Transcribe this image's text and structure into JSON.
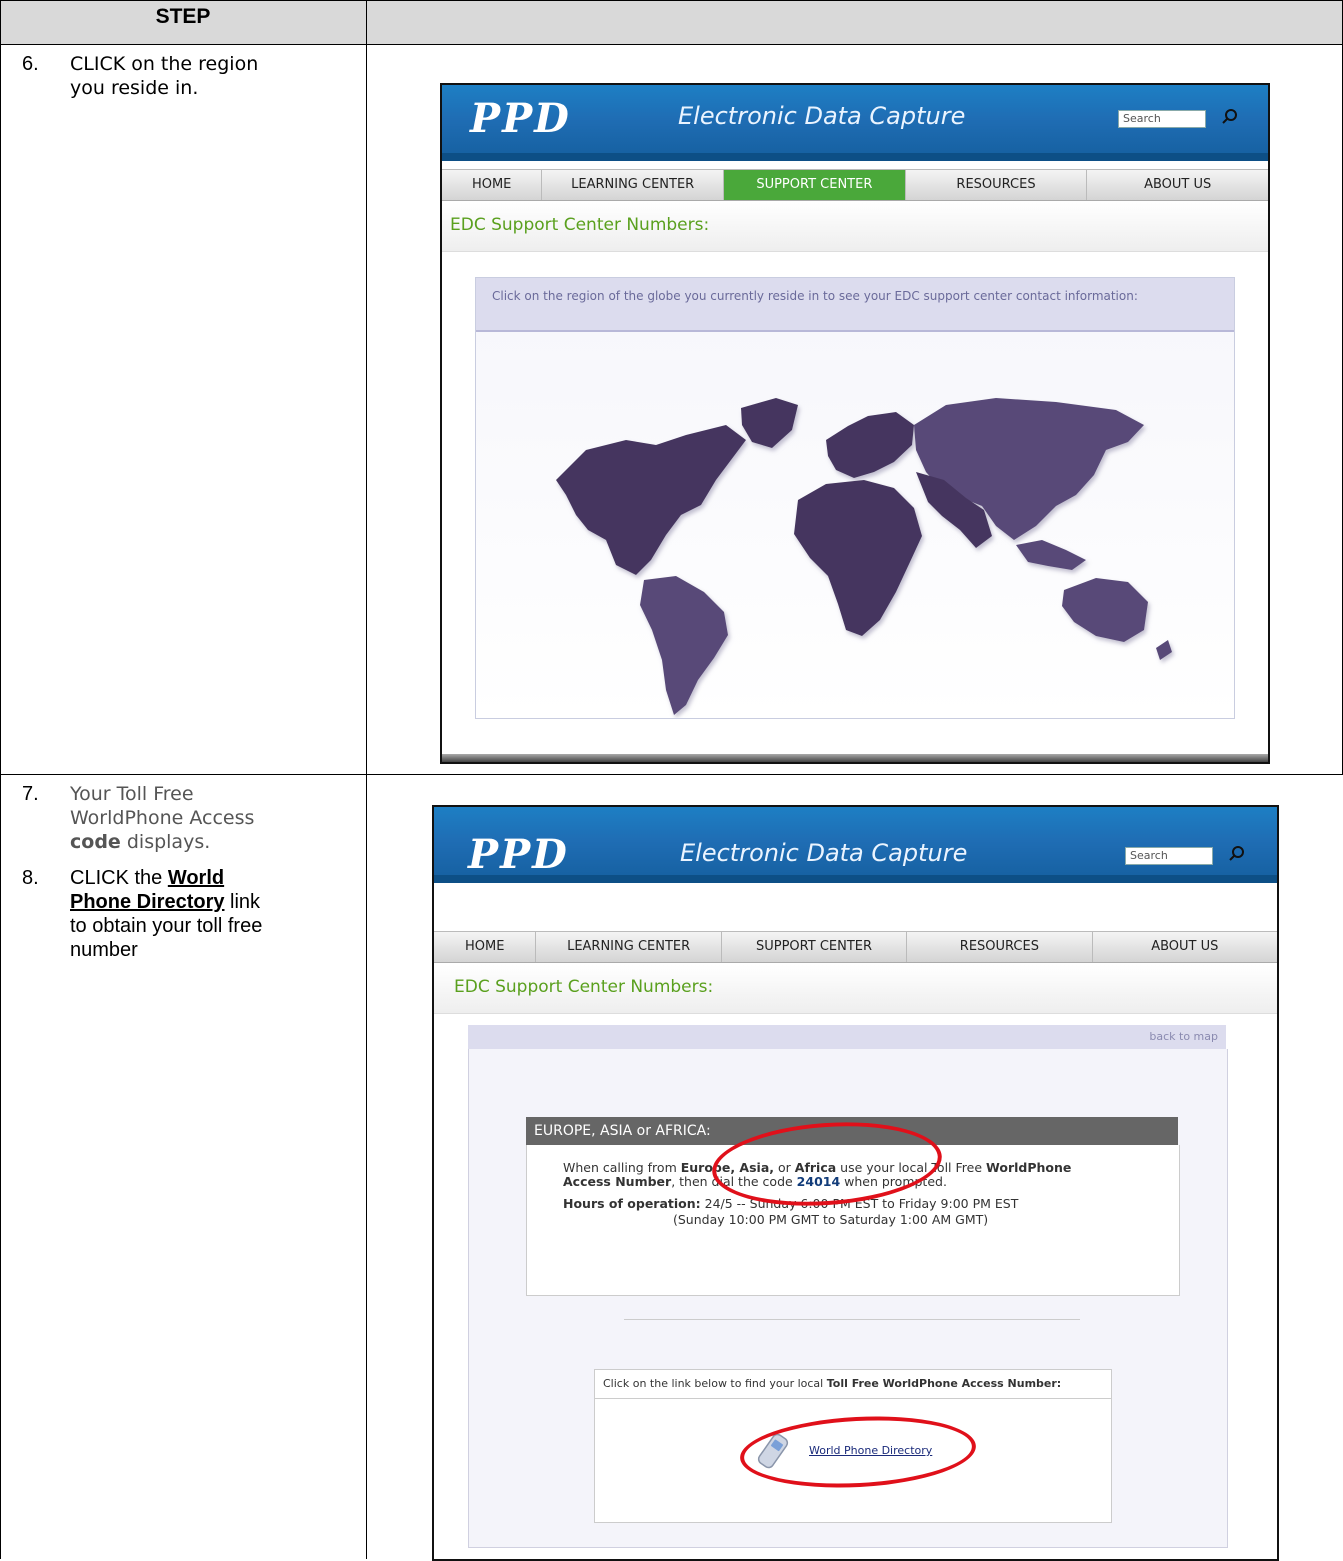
{
  "table": {
    "header_step": "STEP",
    "header_right": ""
  },
  "step6": {
    "number": "6.",
    "text_line1": "CLICK on the region",
    "text_line2": "you reside in."
  },
  "step7": {
    "number": "7.",
    "line1": "Your Toll Free",
    "line2": "WorldPhone Access",
    "line3_bold": "code",
    "line3_rest": " displays."
  },
  "step8": {
    "number": "8.",
    "pre": "CLICK the ",
    "link_line1": "World",
    "link_line2": "Phone Directory",
    "post1": " link",
    "line3": "to obtain your toll free",
    "line4": "number"
  },
  "app": {
    "logo": "PPD",
    "title": "Electronic Data Capture",
    "search_placeholder": "Search",
    "nav": [
      "HOME",
      "LEARNING CENTER",
      "SUPPORT CENTER",
      "RESOURCES",
      "ABOUT US"
    ],
    "active_nav": "SUPPORT CENTER",
    "page_title": "EDC Support Center Numbers:"
  },
  "shot1": {
    "instruction": "Click on the region of the globe you currently reside in to see your EDC support center contact information:"
  },
  "shot2": {
    "back_link": "back to map",
    "region_title": "EUROPE, ASIA or AFRICA:",
    "call_pre": "When calling from ",
    "call_regions_1": "Europe, Asia,",
    "call_or": " or ",
    "call_regions_2": "Africa",
    "call_mid": " use your local Toll Free ",
    "call_bold1": "WorldPhone",
    "call_bold2": "Access Number",
    "call_then": ", then dial the code ",
    "code": "24014",
    "call_end": " when prompted.",
    "hours_label": "Hours of operation:",
    "hours_value": " 24/5 -- Sunday 6:00 PM EST to Friday 9:00 PM EST",
    "hours_gmt": "(Sunday 10:00 PM GMT to Saturday 1:00 AM GMT)",
    "link_instr_pre": "Click on the link below to find your local ",
    "link_instr_bold": "Toll Free WorldPhone Access Number:",
    "link_text": "World Phone Directory"
  },
  "colors": {
    "accent_green": "#4aa83a",
    "map_purple": "#45365e",
    "highlight_red": "#e0101a"
  }
}
